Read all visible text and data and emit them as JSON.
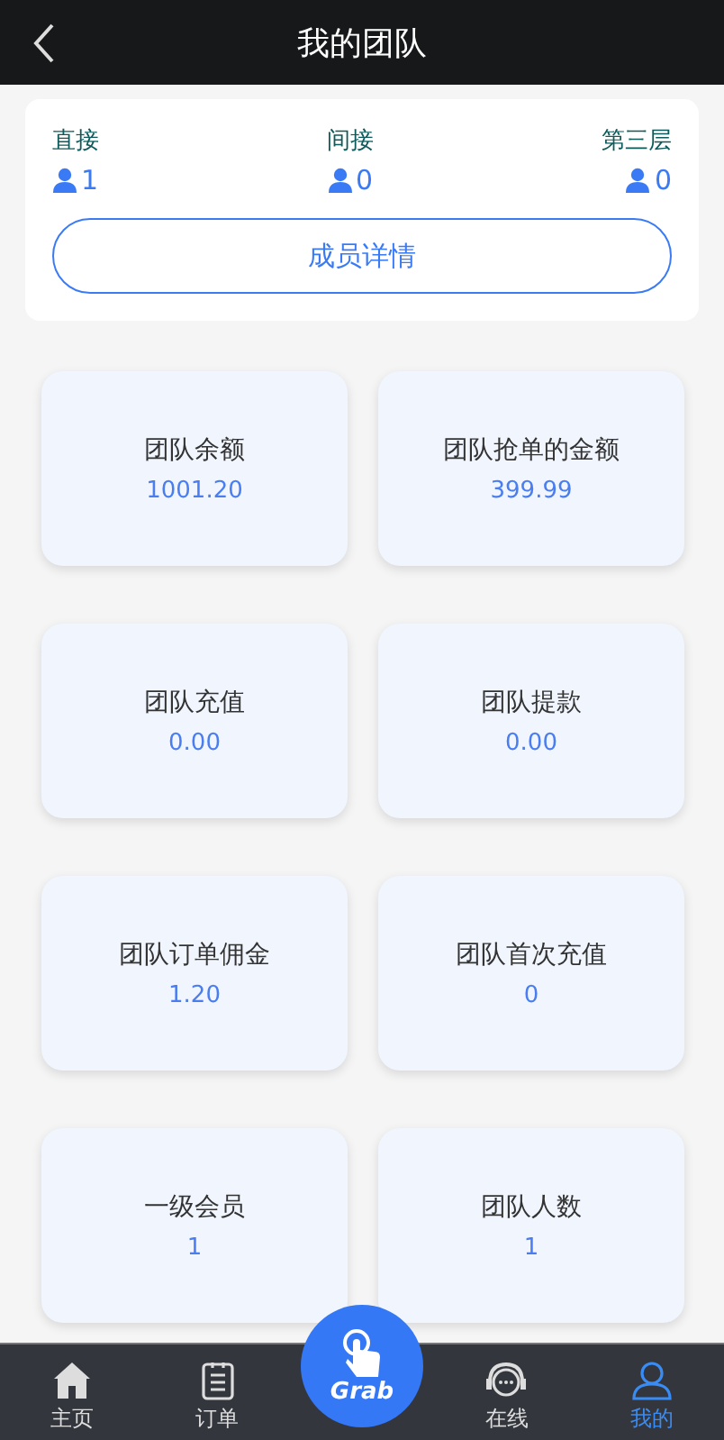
{
  "header": {
    "title": "我的团队"
  },
  "levels": [
    {
      "label": "直接",
      "count": "1"
    },
    {
      "label": "间接",
      "count": "0"
    },
    {
      "label": "第三层",
      "count": "0"
    }
  ],
  "details_button": "成员详情",
  "stats": [
    {
      "label": "团队余额",
      "value": "1001.20"
    },
    {
      "label": "团队抢单的金额",
      "value": "399.99"
    },
    {
      "label": "团队充值",
      "value": "0.00"
    },
    {
      "label": "团队提款",
      "value": "0.00"
    },
    {
      "label": "团队订单佣金",
      "value": "1.20"
    },
    {
      "label": "团队首次充值",
      "value": "0"
    },
    {
      "label": "一级会员",
      "value": "1"
    },
    {
      "label": "团队人数",
      "value": "1"
    }
  ],
  "tabbar": [
    {
      "kind": "home",
      "label": "主页",
      "selected": false
    },
    {
      "kind": "orders",
      "label": "订单",
      "selected": false
    },
    {
      "kind": "grab",
      "label": "Grab",
      "selected": false
    },
    {
      "kind": "online",
      "label": "在线",
      "selected": false
    },
    {
      "kind": "me",
      "label": "我的",
      "selected": true
    }
  ]
}
